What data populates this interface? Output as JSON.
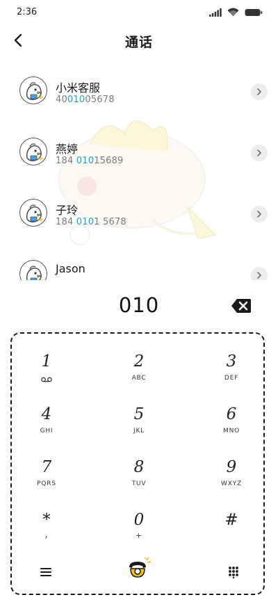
{
  "status": {
    "time": "2:36"
  },
  "header": {
    "title": "通话"
  },
  "contacts": [
    {
      "name": "小米客服",
      "number_parts": [
        "40",
        "010",
        "05678"
      ]
    },
    {
      "name": "燕婷",
      "number_parts": [
        "184 ",
        "010",
        "15689"
      ]
    },
    {
      "name": "子玲",
      "number_parts": [
        "184 ",
        "010",
        "1 5678"
      ]
    },
    {
      "name": "Jason",
      "number_parts": [
        "",
        "",
        ""
      ]
    }
  ],
  "dialer": {
    "number": "010"
  },
  "keypad": {
    "keys": [
      {
        "digit": "1",
        "letters": ""
      },
      {
        "digit": "2",
        "letters": "ABC"
      },
      {
        "digit": "3",
        "letters": "DEF"
      },
      {
        "digit": "4",
        "letters": "GHI"
      },
      {
        "digit": "5",
        "letters": "JKL"
      },
      {
        "digit": "6",
        "letters": "MNO"
      },
      {
        "digit": "7",
        "letters": "PQRS"
      },
      {
        "digit": "8",
        "letters": "TUV"
      },
      {
        "digit": "9",
        "letters": "WXYZ"
      },
      {
        "digit": "*",
        "letters": ","
      },
      {
        "digit": "0",
        "letters": "+"
      },
      {
        "digit": "#",
        "letters": ""
      }
    ]
  },
  "icons": {
    "back": "back-arrow-icon",
    "detail": "chevron-right-icon",
    "backspace": "backspace-icon",
    "voicemail": "voicemail-icon",
    "menu": "menu-icon",
    "call": "phone-call-icon",
    "keypad_toggle": "dialpad-icon"
  },
  "colors": {
    "highlight": "#1aa3d8",
    "text": "#1a1a1a",
    "secondary": "#7b7b7b"
  }
}
